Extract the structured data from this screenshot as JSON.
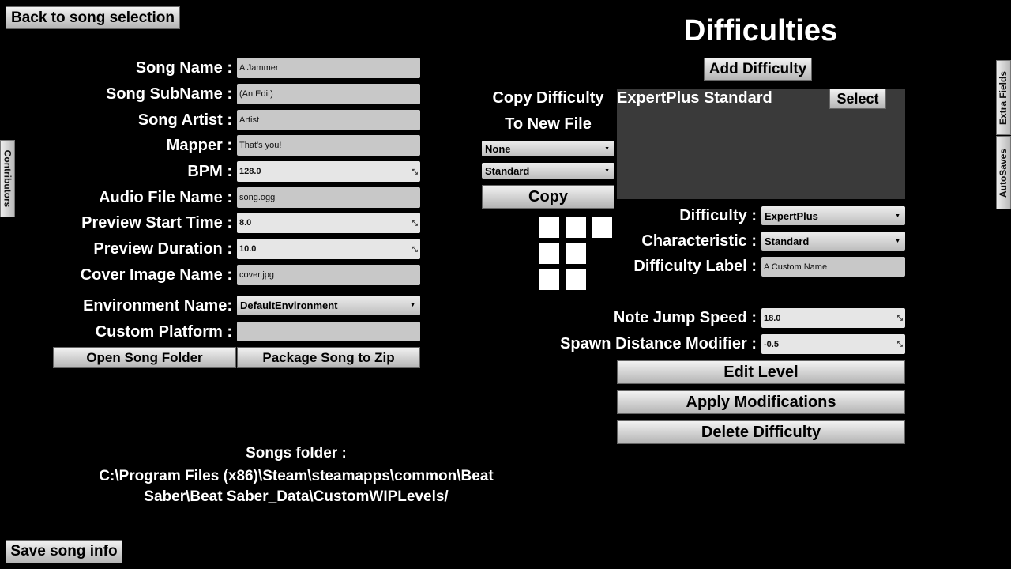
{
  "back_button": "Back to song selection",
  "save_button": "Save song info",
  "contributors_tab": "Contributors",
  "right_tabs": [
    "Extra Fields",
    "AutoSaves"
  ],
  "song_fields": [
    {
      "label": "Song Name :",
      "value": "A Jammer",
      "type": "text"
    },
    {
      "label": "Song SubName :",
      "value": "(An Edit)",
      "type": "text"
    },
    {
      "label": "Song Artist :",
      "value": "Artist",
      "type": "text"
    },
    {
      "label": "Mapper :",
      "value": "That's you!",
      "type": "text"
    },
    {
      "label": "BPM :",
      "value": "128.0",
      "type": "number"
    },
    {
      "label": "Audio File Name :",
      "value": "song.ogg",
      "type": "text"
    },
    {
      "label": "Preview Start Time :",
      "value": "8.0",
      "type": "number"
    },
    {
      "label": "Preview Duration :",
      "value": "10.0",
      "type": "number"
    },
    {
      "label": "Cover Image Name :",
      "value": "cover.jpg",
      "type": "text"
    }
  ],
  "environment": {
    "label": "Environment Name:",
    "value": "DefaultEnvironment"
  },
  "custom_platform": {
    "label": "Custom Platform :",
    "value": ""
  },
  "open_folder_button": "Open Song Folder",
  "package_button": "Package Song to Zip",
  "songs_folder": {
    "label": "Songs folder :",
    "path_line1": "C:\\Program Files (x86)\\Steam\\steamapps\\common\\Beat",
    "path_line2": "Saber\\Beat Saber_Data\\CustomWIPLevels/"
  },
  "difficulties": {
    "title": "Difficulties",
    "add_button": "Add Difficulty",
    "copy": {
      "line1": "Copy Difficulty",
      "line2": "To New File",
      "difficulty_select": "None",
      "characteristic_select": "Standard",
      "button": "Copy"
    },
    "list": [
      {
        "name": "ExpertPlus Standard",
        "select_label": "Select"
      }
    ],
    "difficulty": {
      "label": "Difficulty :",
      "value": "ExpertPlus"
    },
    "characteristic": {
      "label": "Characteristic :",
      "value": "Standard"
    },
    "difficulty_label": {
      "label": "Difficulty Label :",
      "value": "A Custom Name"
    },
    "note_jump_speed": {
      "label": "Note Jump Speed :",
      "value": "18.0"
    },
    "spawn_distance": {
      "label": "Spawn Distance Modifier :",
      "value": "-0.5"
    },
    "edit_button": "Edit Level",
    "apply_button": "Apply Modifications",
    "delete_button": "Delete Difficulty"
  }
}
